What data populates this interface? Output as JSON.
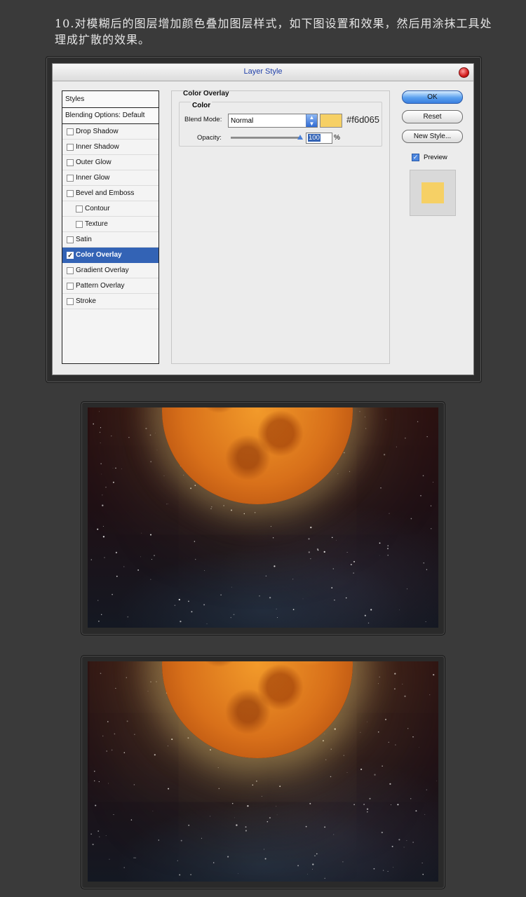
{
  "caption": "10.对模糊后的图层增加颜色叠加图层样式，如下图设置和效果，然后用涂抹工具处理成扩散的效果。",
  "dialog": {
    "title": "Layer Style",
    "styles_header": "Styles",
    "blending_options": "Blending Options: Default",
    "style_items": [
      {
        "label": "Drop Shadow",
        "checked": false,
        "sub": false
      },
      {
        "label": "Inner Shadow",
        "checked": false,
        "sub": false
      },
      {
        "label": "Outer Glow",
        "checked": false,
        "sub": false
      },
      {
        "label": "Inner Glow",
        "checked": false,
        "sub": false
      },
      {
        "label": "Bevel and Emboss",
        "checked": false,
        "sub": false
      },
      {
        "label": "Contour",
        "checked": false,
        "sub": true
      },
      {
        "label": "Texture",
        "checked": false,
        "sub": true
      },
      {
        "label": "Satin",
        "checked": false,
        "sub": false
      },
      {
        "label": "Color Overlay",
        "checked": true,
        "sub": false,
        "selected": true
      },
      {
        "label": "Gradient Overlay",
        "checked": false,
        "sub": false
      },
      {
        "label": "Pattern Overlay",
        "checked": false,
        "sub": false
      },
      {
        "label": "Stroke",
        "checked": false,
        "sub": false
      }
    ],
    "panel_title": "Color Overlay",
    "group_title": "Color",
    "blend_mode_label": "Blend Mode:",
    "blend_mode_value": "Normal",
    "overlay_color": "#f6d065",
    "overlay_color_label": "#f6d065",
    "opacity_label": "Opacity:",
    "opacity_value": "100",
    "opacity_unit": "%",
    "buttons": {
      "ok": "OK",
      "reset": "Reset",
      "new_style": "New Style..."
    },
    "preview_label": "Preview",
    "preview_checked": true
  }
}
